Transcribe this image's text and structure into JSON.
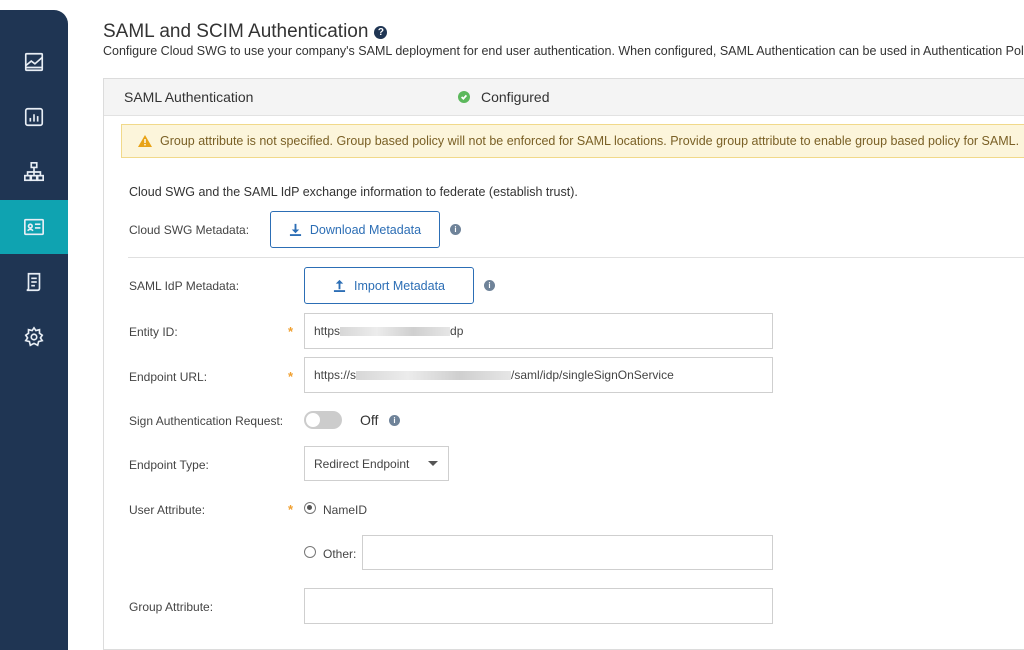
{
  "page": {
    "title": "SAML and SCIM Authentication",
    "help_symbol": "?",
    "description": "Configure Cloud SWG to use your company's SAML deployment for end user authentication. When configured, SAML Authentication can be used in Authentication Pol"
  },
  "sidebar": {
    "items": [
      {
        "icon": "reports-icon",
        "active": false
      },
      {
        "icon": "dashboard-icon",
        "active": false
      },
      {
        "icon": "network-icon",
        "active": false
      },
      {
        "icon": "authentication-icon",
        "active": true
      },
      {
        "icon": "policy-icon",
        "active": false
      },
      {
        "icon": "gear-icon",
        "active": false
      }
    ]
  },
  "card": {
    "title": "SAML Authentication",
    "status": "Configured",
    "status_color": "#5cb85c",
    "warning": "Group attribute is not specified. Group based policy will not be enforced for SAML locations. Provide group attribute to enable group based policy for SAML."
  },
  "form": {
    "intro": "Cloud SWG and the SAML IdP exchange information to federate (establish trust).",
    "swg_metadata_label": "Cloud SWG Metadata:",
    "download_button": "Download Metadata",
    "idp_metadata_label": "SAML IdP Metadata:",
    "import_button": "Import Metadata",
    "info_symbol": "i",
    "required_symbol": "*",
    "entity_id_label": "Entity ID:",
    "entity_id_prefix": "https",
    "entity_id_suffix": "dp",
    "endpoint_url_label": "Endpoint URL:",
    "endpoint_url_prefix": "https://s",
    "endpoint_url_suffix": "/saml/idp/singleSignOnService",
    "sign_request_label": "Sign Authentication Request:",
    "sign_request_state": "Off",
    "endpoint_type_label": "Endpoint Type:",
    "endpoint_type_value": "Redirect Endpoint",
    "user_attribute_label": "User Attribute:",
    "option_nameid": "NameID",
    "option_other": "Other:",
    "group_attribute_label": "Group Attribute:"
  },
  "colors": {
    "sidebar": "#1f3553",
    "active": "#0fa3b1",
    "accent": "#2c6eb5",
    "warning_bg": "#fcf5db",
    "required": "#f0a030"
  }
}
